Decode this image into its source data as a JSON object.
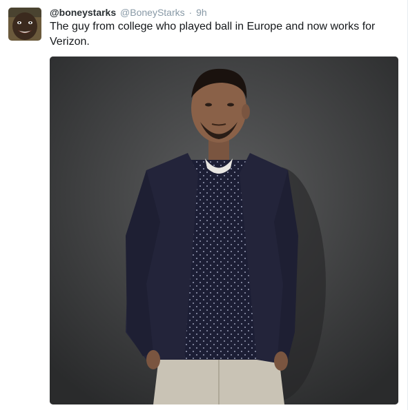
{
  "tweet": {
    "display_name": "@boneystarks",
    "screen_name": "@BoneyStarks",
    "separator": "·",
    "timestamp": "9h",
    "text": "The guy from college who played ball in Europe and now works for Verizon."
  },
  "media": {
    "description_icon": "photo-man-in-cardigan"
  },
  "colors": {
    "name": "#292f33",
    "meta": "#8899a6",
    "text": "#14171a",
    "photo_background": "#3a3b3c"
  }
}
